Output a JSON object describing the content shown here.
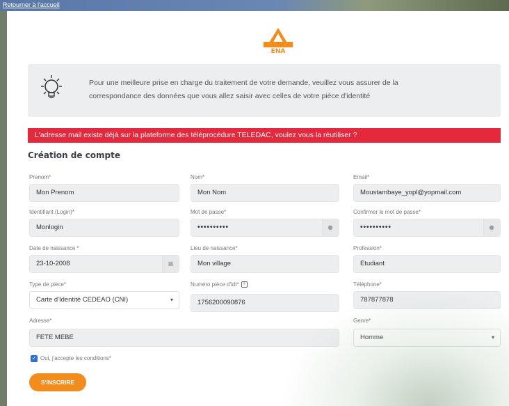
{
  "nav": {
    "back_link": "Retourner à l'accueil"
  },
  "logo": {
    "brand": "ENA"
  },
  "info": {
    "message_line1": "Pour une meilleure prise en charge du traitement de votre demande, veuillez vous assurer de la",
    "message_line2": "correspondance des données que vous allez saisir avec celles de votre pièce d'identité"
  },
  "alert": {
    "text": "L'adresse mail existe déjà sur la plateforme des téléprocédure TELEDAC, voulez vous la réutiliser ?"
  },
  "form": {
    "title": "Création de compte",
    "prenom": {
      "label": "Prenom*",
      "value": "Mon Prenom"
    },
    "nom": {
      "label": "Nom*",
      "value": "Mon Nom"
    },
    "email": {
      "label": "Email*",
      "value": "Moustambaye_yopl@yopmail.com"
    },
    "identifiant": {
      "label": "Identifiant (Login)*",
      "value": "Monlogin"
    },
    "mot_de_passe": {
      "label": "Mot de passe*",
      "value": "••••••••••"
    },
    "confirmer_mdp": {
      "label": "Confirmer le mot de passe*",
      "value": "••••••••••"
    },
    "date_naissance": {
      "label": "Date de naissance *",
      "value": "23-10-2008"
    },
    "lieu_naissance": {
      "label": "Lieu de naissance*",
      "value": "Mon village"
    },
    "profession": {
      "label": "Profession*",
      "value": "Etudiant"
    },
    "type_piece": {
      "label": "Type de pièce*",
      "value": "Carte d'Identité CEDEAO (CNI)"
    },
    "numero_piece": {
      "label": "Numéro pièce d'idt*",
      "value": "1756200090876"
    },
    "telephone": {
      "label": "Téléphone*",
      "value": "787877878"
    },
    "adresse": {
      "label": "Adresse*",
      "value": "FETE MEBE"
    },
    "genre": {
      "label": "Genre*",
      "value": "Homme"
    },
    "terms": {
      "label": "Oui, j'accepte les conditions*"
    },
    "submit": {
      "label": "S'INSCRIRE"
    }
  }
}
